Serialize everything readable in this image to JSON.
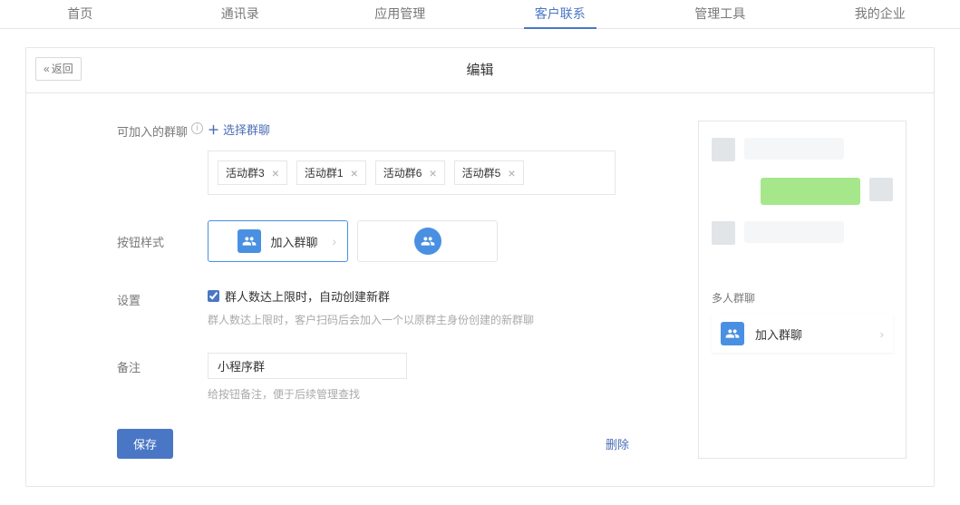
{
  "nav": {
    "items": [
      {
        "label": "首页"
      },
      {
        "label": "通讯录"
      },
      {
        "label": "应用管理"
      },
      {
        "label": "客户联系",
        "active": true
      },
      {
        "label": "管理工具"
      },
      {
        "label": "我的企业"
      }
    ]
  },
  "header": {
    "back": "返回",
    "title": "编辑"
  },
  "form": {
    "groups_label": "可加入的群聊",
    "select_groups": "选择群聊",
    "group_tags": [
      "活动群3",
      "活动群1",
      "活动群6",
      "活动群5"
    ],
    "button_style_label": "按钮样式",
    "join_chat_label": "加入群聊",
    "settings_label": "设置",
    "auto_create_label": "群人数达上限时，自动创建新群",
    "auto_create_help": "群人数达上限时，客户扫码后会加入一个以原群主身份创建的新群聊",
    "remark_label": "备注",
    "remark_value": "小程序群",
    "remark_help": "给按钮备注，便于后续管理查找",
    "save": "保存",
    "delete": "删除"
  },
  "preview": {
    "label": "多人群聊",
    "join_label": "加入群聊"
  }
}
